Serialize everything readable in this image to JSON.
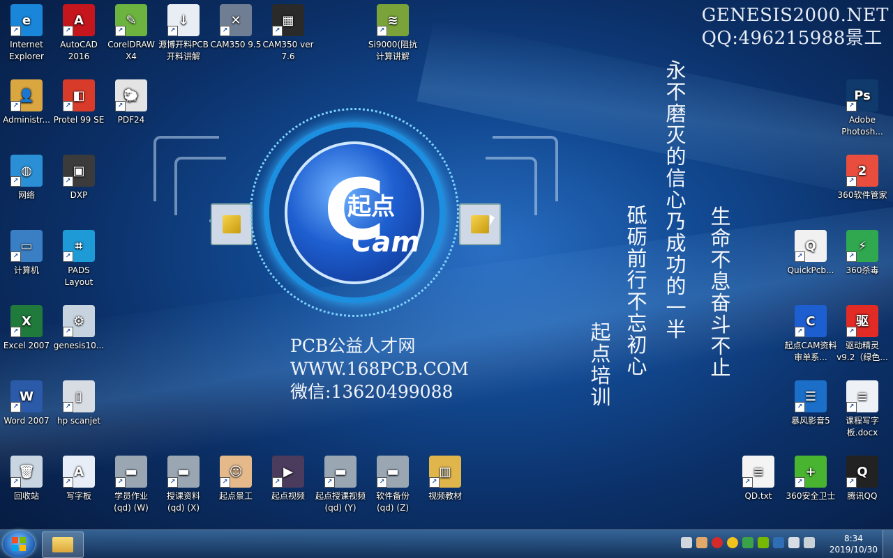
{
  "watermark": {
    "line1": "GENESIS2000.NET",
    "line2": "QQ:496215988景工"
  },
  "desktop_icons": [
    {
      "label": "Internet Explorer",
      "icon": "ie-icon",
      "color": "#1a86d9",
      "glyph": "e"
    },
    {
      "label": "AutoCAD 2016",
      "icon": "autocad-icon",
      "color": "#c4161c",
      "glyph": "A"
    },
    {
      "label": "CorelDRAW X4",
      "icon": "coreldraw-icon",
      "color": "#6cb33f",
      "glyph": "✎"
    },
    {
      "label": "源博开料PCB开料讲解",
      "icon": "pcb-cutting-icon",
      "color": "#e8eef4",
      "glyph": "↓"
    },
    {
      "label": "CAM350 9.5",
      "icon": "cam350-icon",
      "color": "#6f7e92",
      "glyph": "✕"
    },
    {
      "label": "CAM350 ver 7.6",
      "icon": "cam350-old-icon",
      "color": "#2a2a2a",
      "glyph": "▦"
    },
    {
      "label": "Si9000(阻抗计算讲解",
      "icon": "si9000-icon",
      "color": "#7aa43a",
      "glyph": "≋"
    },
    {
      "label": "Administr...",
      "icon": "user-folder-icon",
      "color": "#d9a640",
      "glyph": "👤"
    },
    {
      "label": "Protel 99 SE",
      "icon": "protel-icon",
      "color": "#d93b2b",
      "glyph": "◧"
    },
    {
      "label": "PDF24",
      "icon": "pdf24-icon",
      "color": "#e4e4e4",
      "glyph": "🐑"
    },
    {
      "label": "网络",
      "icon": "network-icon",
      "color": "#2b8fd6",
      "glyph": "◍"
    },
    {
      "label": "DXP",
      "icon": "dxp-icon",
      "color": "#3b3b3b",
      "glyph": "▣"
    },
    {
      "label": "计算机",
      "icon": "computer-icon",
      "color": "#3a7fc4",
      "glyph": "▭"
    },
    {
      "label": "PADS Layout",
      "icon": "pads-icon",
      "color": "#1e9ad6",
      "glyph": "⌗"
    },
    {
      "label": "Excel 2007",
      "icon": "excel-icon",
      "color": "#1f7a3c",
      "glyph": "X"
    },
    {
      "label": "genesis10...",
      "icon": "genesis-icon",
      "color": "#c7d3df",
      "glyph": "⚙"
    },
    {
      "label": "Word 2007",
      "icon": "word-icon",
      "color": "#2a5aa8",
      "glyph": "W"
    },
    {
      "label": "hp scanjet",
      "icon": "scanner-icon",
      "color": "#d8dde3",
      "glyph": "▯"
    },
    {
      "label": "回收站",
      "icon": "recycle-bin-icon",
      "color": "#c9d6e2",
      "glyph": "🗑"
    },
    {
      "label": "写字板",
      "icon": "wordpad-icon",
      "color": "#e8eef8",
      "glyph": "A"
    },
    {
      "label": "学员作业 (qd) (W)",
      "icon": "network-drive-icon",
      "color": "#9aa7b3",
      "glyph": "▬"
    },
    {
      "label": "授课资料 (qd) (X)",
      "icon": "network-drive-icon",
      "color": "#9aa7b3",
      "glyph": "▬"
    },
    {
      "label": "起点景工",
      "icon": "person-icon",
      "color": "#e5b98a",
      "glyph": "☺"
    },
    {
      "label": "起点视频",
      "icon": "video-folder-icon",
      "color": "#4b3b5c",
      "glyph": "▶"
    },
    {
      "label": "起点授课视频 (qd) (Y)",
      "icon": "network-drive-icon",
      "color": "#9aa7b3",
      "glyph": "▬"
    },
    {
      "label": "软件备份 (qd) (Z)",
      "icon": "network-drive-icon",
      "color": "#9aa7b3",
      "glyph": "▬"
    },
    {
      "label": "视频教材",
      "icon": "folder-icon",
      "color": "#e0b54b",
      "glyph": "▥"
    },
    {
      "label": "Adobe Photosh...",
      "icon": "photoshop-icon",
      "color": "#0f3a6b",
      "glyph": "Ps"
    },
    {
      "label": "360软件管家",
      "icon": "360-software-icon",
      "color": "#e84d3d",
      "glyph": "2"
    },
    {
      "label": "QuickPcb...",
      "icon": "quickpcb-icon",
      "color": "#f1f1f1",
      "glyph": "Q"
    },
    {
      "label": "360杀毒",
      "icon": "360-antivirus-icon",
      "color": "#2fa84f",
      "glyph": "⚡"
    },
    {
      "label": "起点CAM资料审单系...",
      "icon": "qidian-cam-icon",
      "color": "#1d5fd0",
      "glyph": "C"
    },
    {
      "label": "驱动精灵 v9.2（绿色...",
      "icon": "driver-genius-icon",
      "color": "#e22b24",
      "glyph": "驱"
    },
    {
      "label": "暴风影音5",
      "icon": "storm-player-icon",
      "color": "#1b6fc8",
      "glyph": "☰"
    },
    {
      "label": "课程写字板.docx",
      "icon": "docx-icon",
      "color": "#eef2f7",
      "glyph": "≡"
    },
    {
      "label": "QD.txt",
      "icon": "txt-icon",
      "color": "#f4f4f4",
      "glyph": "≡"
    },
    {
      "label": "360安全卫士",
      "icon": "360-security-icon",
      "color": "#48b430",
      "glyph": "+"
    },
    {
      "label": "腾讯QQ",
      "icon": "qq-icon",
      "color": "#222",
      "glyph": "Q"
    }
  ],
  "wallpaper": {
    "logo_text_top": "起点",
    "logo_text_bottom": "Cam",
    "site_lines": [
      "PCB公益人才网",
      "WWW.168PCB.COM",
      "微信:13620499088"
    ],
    "vertical_texts": [
      "永不磨灭的信心乃成功的一半",
      "生命不息奋斗不止",
      "砥砺前行不忘初心",
      "起点培训"
    ]
  },
  "taskbar": {
    "time": "8:34",
    "date": "2019/10/30"
  }
}
